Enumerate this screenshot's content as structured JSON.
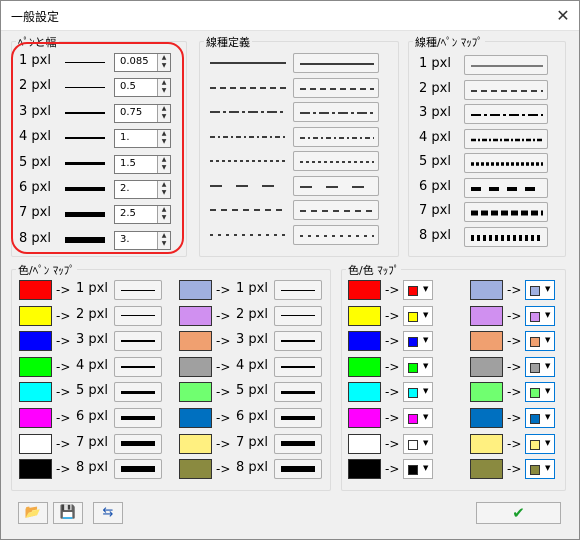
{
  "window": {
    "title": "一般設定",
    "close_glyph": "✕"
  },
  "pen_width": {
    "legend": "ﾍﾟﾝと幅",
    "rows": [
      {
        "label": "1 pxl",
        "value": "0.085"
      },
      {
        "label": "2 pxl",
        "value": "0.5"
      },
      {
        "label": "3 pxl",
        "value": "0.75"
      },
      {
        "label": "4 pxl",
        "value": "1."
      },
      {
        "label": "5 pxl",
        "value": "1.5"
      },
      {
        "label": "6 pxl",
        "value": "2."
      },
      {
        "label": "7 pxl",
        "value": "2.5"
      },
      {
        "label": "8 pxl",
        "value": "3."
      }
    ]
  },
  "linetype": {
    "legend": "線種定義"
  },
  "linetype_pen": {
    "legend": "線種/ﾍﾟﾝ ﾏｯﾌﾟ",
    "rows": [
      {
        "label": "1 pxl"
      },
      {
        "label": "2 pxl"
      },
      {
        "label": "3 pxl"
      },
      {
        "label": "4 pxl"
      },
      {
        "label": "5 pxl"
      },
      {
        "label": "6 pxl"
      },
      {
        "label": "7 pxl"
      },
      {
        "label": "8 pxl"
      }
    ]
  },
  "color_pen": {
    "legend": "色/ﾍﾟﾝ ﾏｯﾌﾟ",
    "arrow": "->",
    "left": [
      {
        "color": "#ff0000",
        "label": "1 pxl"
      },
      {
        "color": "#ffff00",
        "label": "2 pxl"
      },
      {
        "color": "#0000ff",
        "label": "3 pxl"
      },
      {
        "color": "#00ff00",
        "label": "4 pxl"
      },
      {
        "color": "#00ffff",
        "label": "5 pxl"
      },
      {
        "color": "#ff00ff",
        "label": "6 pxl"
      },
      {
        "color": "#ffffff",
        "label": "7 pxl"
      },
      {
        "color": "#000000",
        "label": "8 pxl"
      }
    ],
    "right": [
      {
        "color": "#a0b0e0",
        "label": "1 pxl"
      },
      {
        "color": "#d090f0",
        "label": "2 pxl"
      },
      {
        "color": "#f0a070",
        "label": "3 pxl"
      },
      {
        "color": "#a0a0a0",
        "label": "4 pxl"
      },
      {
        "color": "#70ff70",
        "label": "5 pxl"
      },
      {
        "color": "#0070c0",
        "label": "6 pxl"
      },
      {
        "color": "#fff080",
        "label": "7 pxl"
      },
      {
        "color": "#8a8a40",
        "label": "8 pxl"
      }
    ]
  },
  "color_color": {
    "legend": "色/色 ﾏｯﾌﾟ",
    "arrow": "->",
    "left": [
      "#ff0000",
      "#ffff00",
      "#0000ff",
      "#00ff00",
      "#00ffff",
      "#ff00ff",
      "#ffffff",
      "#000000"
    ],
    "right": [
      "#a0b0e0",
      "#d090f0",
      "#f0a070",
      "#a0a0a0",
      "#70ff70",
      "#0070c0",
      "#fff080",
      "#8a8a40"
    ]
  },
  "toolbar": {
    "open_icon": "📂",
    "save_icon": "💾",
    "swap_icon": "⇆",
    "ok_glyph": "✔"
  }
}
